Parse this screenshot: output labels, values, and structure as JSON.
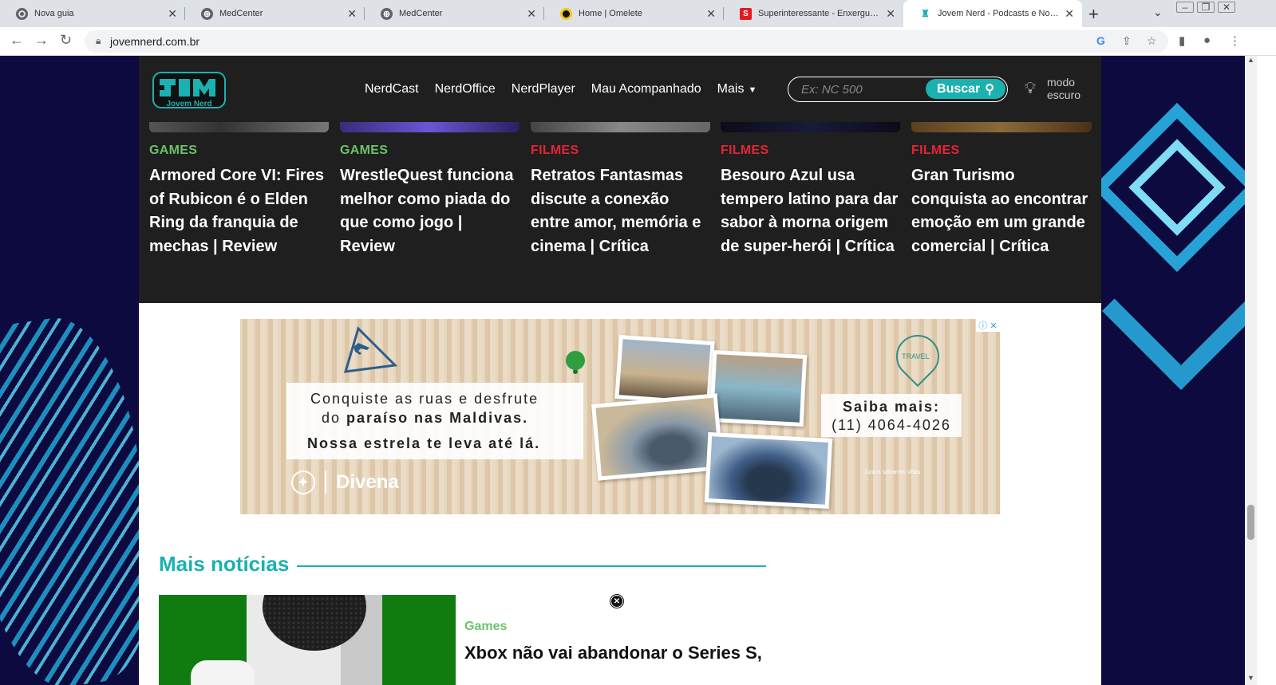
{
  "browser": {
    "tabs": [
      {
        "title": "Nova guia",
        "favicon": "chrome-icon"
      },
      {
        "title": "MedCenter",
        "favicon": "globe-icon"
      },
      {
        "title": "MedCenter",
        "favicon": "globe-icon"
      },
      {
        "title": "Home | Omelete",
        "favicon": "omelete-icon"
      },
      {
        "title": "Superinteressante - Enxergue alé",
        "favicon": "super-icon"
      },
      {
        "title": "Jovem Nerd - Podcasts e Notícias",
        "favicon": "jovemnerd-icon",
        "active": true
      }
    ],
    "url": "jovemnerd.com.br"
  },
  "site": {
    "logo_alt": "Jovem Nerd",
    "nav": [
      "NerdCast",
      "NerdOffice",
      "NerdPlayer",
      "Mau Acompanhado",
      "Mais"
    ],
    "search": {
      "placeholder": "Ex: NC 500",
      "button": "Buscar"
    },
    "dark_mode": {
      "line1": "modo",
      "line2": "escuro"
    }
  },
  "cards": [
    {
      "category": "GAMES",
      "title": "Armored Core VI: Fires of Rubicon é o Elden Ring da franquia de mechas | Review"
    },
    {
      "category": "GAMES",
      "title": "WrestleQuest funciona melhor como piada do que como jogo | Review"
    },
    {
      "category": "FILMES",
      "title": "Retratos Fantasmas discute a conexão entre amor, memória e cinema | Crítica"
    },
    {
      "category": "FILMES",
      "title": "Besouro Azul usa tempero latino para dar sabor à morna origem de super-herói | Crítica"
    },
    {
      "category": "FILMES",
      "title": "Gran Turismo conquista ao encontrar emoção em um grande comercial | Crítica"
    }
  ],
  "ad": {
    "line1": "Conquiste as ruas e desfrute",
    "line2_prefix": "do ",
    "line2_bold": "paraíso nas Maldivas.",
    "line3": "Nossa estrela te leva até lá.",
    "brand": "Divena",
    "cta": "Saiba mais:",
    "phone": "(11) 4064-4026",
    "badge": "TRAVEL",
    "footnote": "Juntos salvamos vidas"
  },
  "more_news": {
    "heading": "Mais notícias",
    "items": [
      {
        "category": "Games",
        "title": "Xbox não vai abandonar o Series S,"
      }
    ]
  },
  "colors": {
    "accent": "#1bb1b0",
    "games": "#6ec16b",
    "filmes": "#e32536",
    "header_bg": "#1f1f1f"
  }
}
